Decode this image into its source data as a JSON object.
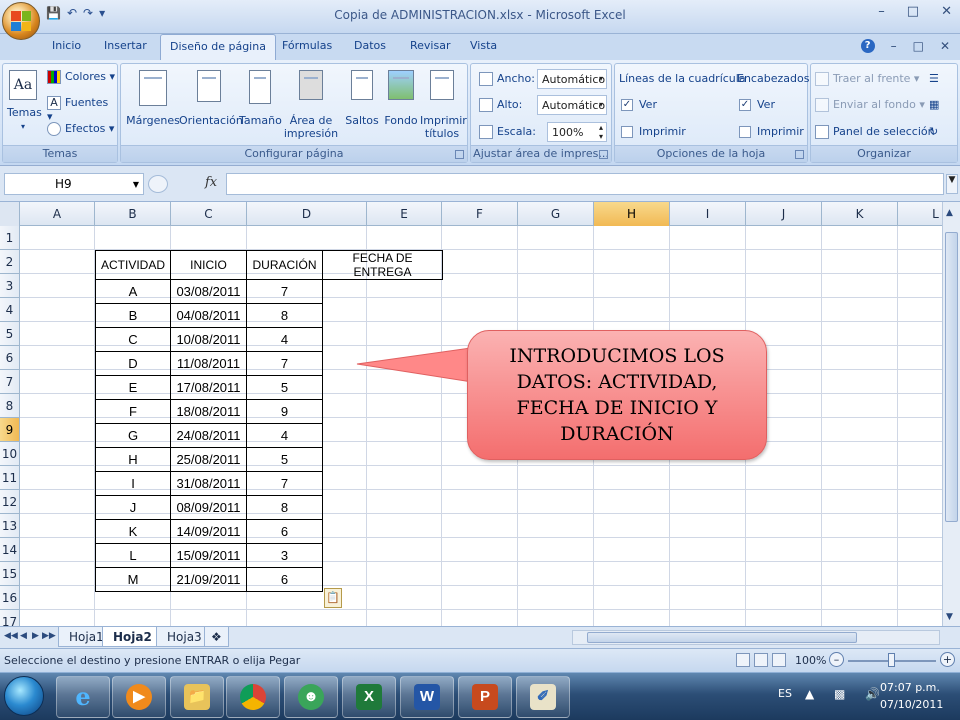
{
  "window": {
    "title": "Copia de ADMINISTRACION.xlsx - Microsoft Excel",
    "controls": [
      "–",
      "□",
      "✕"
    ],
    "doc_controls": [
      "–",
      "□",
      "✕"
    ]
  },
  "ribbon_tabs": [
    "Inicio",
    "Insertar",
    "Diseño de página",
    "Fórmulas",
    "Datos",
    "Revisar",
    "Vista"
  ],
  "ribbon": {
    "temas": {
      "label": "Temas",
      "big_button": "Temas",
      "colores": "Colores",
      "fuentes": "Fuentes",
      "efectos": "Efectos"
    },
    "configurar": {
      "label": "Configurar página",
      "buttons": [
        "Márgenes",
        "Orientación",
        "Tamaño",
        "Área de impresión",
        "Saltos",
        "Fondo",
        "Imprimir títulos"
      ]
    },
    "ajustar": {
      "label": "Ajustar área de impres...",
      "ancho_label": "Ancho:",
      "ancho_value": "Automático",
      "alto_label": "Alto:",
      "alto_value": "Automático",
      "escala_label": "Escala:",
      "escala_value": "100%"
    },
    "opciones": {
      "label": "Opciones de la hoja",
      "gridlines_title": "Líneas de la cuadrícula",
      "headings_title": "Encabezados",
      "ver": "Ver",
      "imprimir": "Imprimir"
    },
    "organizar": {
      "label": "Organizar",
      "traer": "Traer al frente",
      "enviar": "Enviar al fondo",
      "panel": "Panel de selección"
    }
  },
  "formula_bar": {
    "name_box": "H9",
    "fx": "fx",
    "formula": ""
  },
  "grid": {
    "columns": [
      "A",
      "B",
      "C",
      "D",
      "E",
      "F",
      "G",
      "H",
      "I",
      "J",
      "K",
      "L"
    ],
    "selected_column": "H",
    "rows": [
      "1",
      "2",
      "3",
      "4",
      "5",
      "6",
      "7",
      "8",
      "9",
      "10",
      "11",
      "12",
      "13",
      "14",
      "15",
      "16",
      "17"
    ],
    "selected_row": "9"
  },
  "table": {
    "headers": [
      "ACTIVIDAD",
      "INICIO",
      "DURACIÓN",
      "FECHA DE ENTREGA"
    ],
    "rows": [
      [
        "A",
        "03/08/2011",
        "7"
      ],
      [
        "B",
        "04/08/2011",
        "8"
      ],
      [
        "C",
        "10/08/2011",
        "4"
      ],
      [
        "D",
        "11/08/2011",
        "7"
      ],
      [
        "E",
        "17/08/2011",
        "5"
      ],
      [
        "F",
        "18/08/2011",
        "9"
      ],
      [
        "G",
        "24/08/2011",
        "4"
      ],
      [
        "H",
        "25/08/2011",
        "5"
      ],
      [
        "I",
        "31/08/2011",
        "7"
      ],
      [
        "J",
        "08/09/2011",
        "8"
      ],
      [
        "K",
        "14/09/2011",
        "6"
      ],
      [
        "L",
        "15/09/2011",
        "3"
      ],
      [
        "M",
        "21/09/2011",
        "6"
      ]
    ]
  },
  "callout": {
    "text": "INTRODUCIMOS LOS DATOS: ACTIVIDAD, FECHA DE INICIO Y DURACIÓN",
    "color": "#f47c7c"
  },
  "sheet_tabs": [
    "Hoja1",
    "Hoja2",
    "Hoja3"
  ],
  "active_sheet": "Hoja2",
  "status": {
    "text": "Seleccione el destino y presione ENTRAR o elija Pegar",
    "zoom": "100%",
    "zoom_minus": "–",
    "zoom_plus": "+"
  },
  "taskbar": {
    "apps": [
      "internet-explorer",
      "media-player",
      "file-explorer",
      "chrome",
      "messenger",
      "excel",
      "word",
      "powerpoint",
      "paint"
    ],
    "language": "ES",
    "time": "07:07 p.m.",
    "date": "07/10/2011"
  }
}
